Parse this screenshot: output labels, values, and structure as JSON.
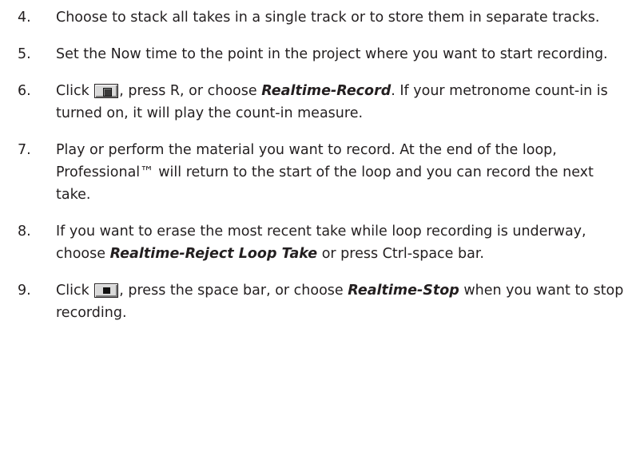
{
  "steps": [
    {
      "num": "4.",
      "text": "Choose to stack all takes in a single track or to store them in separate tracks."
    },
    {
      "num": "5.",
      "text": "Set the Now time to the point in the project where you want to start recording."
    },
    {
      "num": "6.",
      "pre": "Click ",
      "button_icon": "record-icon",
      "mid": ", press R, or choose ",
      "menu": "Realtime-Record",
      "post": ". If your metronome count-in is turned on, it will play the count-in measure."
    },
    {
      "num": "7.",
      "text": "Play or perform the material you want to record. At the end of the loop, Professional™ will return to the start of the loop and you can record the next take."
    },
    {
      "num": "8.",
      "pre": "If you want to erase the most recent take while loop recording is underway, choose ",
      "menu": "Realtime-Reject Loop Take",
      "post": " or press Ctrl-space bar."
    },
    {
      "num": "9.",
      "pre": "Click ",
      "button_icon": "stop-icon",
      "mid": ", press the space bar, or choose ",
      "menu": "Realtime-Stop",
      "post": " when you want to stop recording."
    }
  ]
}
